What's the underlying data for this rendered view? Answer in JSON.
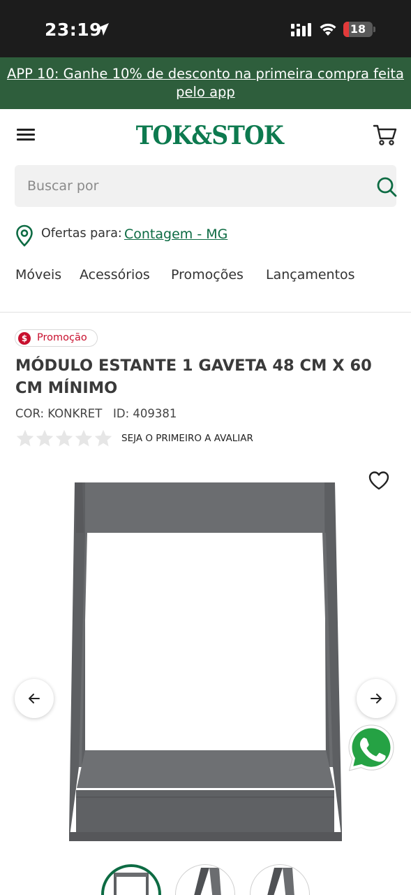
{
  "status_bar": {
    "time": "23:19",
    "battery_level": "18",
    "battery_fraction": 0.18,
    "icons": [
      "location-arrow-icon",
      "cellular-signal-icon",
      "wifi-icon",
      "battery-icon"
    ]
  },
  "promo_banner": {
    "text": "APP 10: Ganhe 10% de desconto na primeira compra feita pelo app",
    "background": "#2e5e3c"
  },
  "header": {
    "logo_text": "TOK&STOK",
    "brand_color": "#0d7a4f",
    "menu_icon": "hamburger-menu-icon",
    "cart_icon": "shopping-cart-icon"
  },
  "search": {
    "placeholder": "Buscar por",
    "value": "",
    "icon": "search-icon"
  },
  "location": {
    "label": "Ofertas para:",
    "city": "Contagem - MG",
    "icon": "location-pin-icon"
  },
  "nav": {
    "items": [
      {
        "label": "Móveis"
      },
      {
        "label": "Acessórios"
      },
      {
        "label": "Promoções"
      },
      {
        "label": "Lançamentos"
      }
    ]
  },
  "product": {
    "badge_symbol": "$",
    "badge": "Promoção",
    "title": "MÓDULO ESTANTE 1 GAVETA 48 CM X 60 CM MÍNIMO",
    "meta": "COR: KONKRET   ID: 409381",
    "rating": 0,
    "rating_max": 5,
    "rating_cta": "SEJA O PRIMEIRO A AVALIAR",
    "accent_color": "#c8102e",
    "image_color": "#6b6d70"
  },
  "gallery": {
    "favorite_icon": "heart-outline-icon",
    "prev_icon": "arrow-left-icon",
    "next_icon": "arrow-right-icon",
    "whatsapp_icon": "whatsapp-icon",
    "thumbnail_count": 3,
    "active_thumbnail": 0
  }
}
